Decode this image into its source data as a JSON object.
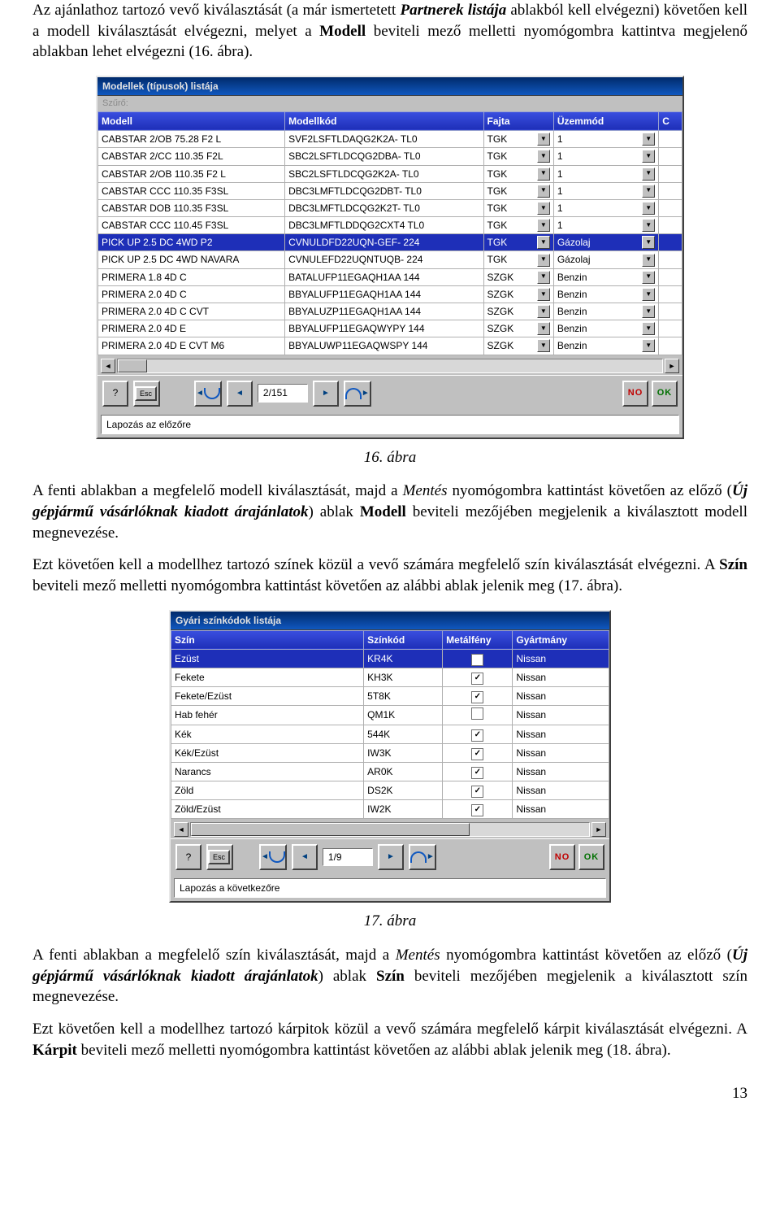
{
  "text": {
    "p1_pre": "Az ajánlathoz tartozó vevő kiválasztását (a már ismertetett ",
    "p1_b1": "Partnerek listája",
    "p1_mid1": " ablakból kell elvégezni) követően kell a modell kiválasztását elvégezni, melyet a ",
    "p1_b2": "Modell",
    "p1_post": " beviteli mező melletti nyomógombra kattintva megjelenő ablakban lehet elvégezni (16. ábra).",
    "cap1": "16. ábra",
    "p2_pre": "A fenti ablakban a megfelelő modell kiválasztását, majd a ",
    "p2_i1": "Mentés",
    "p2_mid1": " nyomógombra kattintást követően az előző (",
    "p2_b1": "Új gépjármű vásárlóknak kiadott árajánlatok",
    "p2_mid2": ") ablak ",
    "p2_b2": "Modell",
    "p2_post": " beviteli mezőjében megjelenik a kiválasztott modell megnevezése.",
    "p3_pre": "Ezt követően kell a modellhez tartozó színek közül a vevő számára megfelelő szín kiválasztását elvégezni. A ",
    "p3_b1": "Szín",
    "p3_post": " beviteli mező melletti nyomógombra kattintást követően az alábbi ablak jelenik meg (17. ábra).",
    "cap2": "17. ábra",
    "p4_pre": "A fenti ablakban a megfelelő szín kiválasztását, majd a ",
    "p4_i1": "Mentés",
    "p4_mid1": " nyomógombra kattintást követően az előző (",
    "p4_b1": "Új gépjármű vásárlóknak kiadott árajánlatok",
    "p4_mid2": ") ablak ",
    "p4_b2": "Szín",
    "p4_post": " beviteli mezőjében megjelenik a kiválasztott szín megnevezése.",
    "p5_pre": "Ezt követően kell a modellhez tartozó kárpitok közül a vevő számára megfelelő kárpit kiválasztását elvégezni. A ",
    "p5_b1": "Kárpit",
    "p5_post": " beviteli mező melletti nyomógombra kattintást követően az alábbi ablak jelenik meg (18. ábra).",
    "pagenum": "13"
  },
  "win1": {
    "title": "Modellek (típusok) listája",
    "hint": "Szűrő:",
    "headers": [
      "Modell",
      "Modellkód",
      "Fajta",
      "Üzemmód",
      "C"
    ],
    "rows": [
      {
        "c": [
          "CABSTAR 2/OB 75.28 F2 L",
          "SVF2LSFTLDAQG2K2A- TL0",
          "TGK",
          "1"
        ]
      },
      {
        "c": [
          "CABSTAR 2/CC 110.35 F2L",
          "SBC2LSFTLDCQG2DBA- TL0",
          "TGK",
          "1"
        ]
      },
      {
        "c": [
          "CABSTAR 2/OB 110.35 F2 L",
          "SBC2LSFTLDCQG2K2A- TL0",
          "TGK",
          "1"
        ]
      },
      {
        "c": [
          "CABSTAR CCC 110.35 F3SL",
          "DBC3LMFTLDCQG2DBT- TL0",
          "TGK",
          "1"
        ]
      },
      {
        "c": [
          "CABSTAR DOB 110.35 F3SL",
          "DBC3LMFTLDCQG2K2T- TL0",
          "TGK",
          "1"
        ]
      },
      {
        "c": [
          "CABSTAR CCC 110.45 F3SL",
          "DBC3LMFTLDDQG2CXT4 TL0",
          "TGK",
          "1"
        ]
      },
      {
        "c": [
          "PICK UP 2.5 DC 4WD P2",
          "CVNULDFD22UQN-GEF- 224",
          "TGK",
          "Gázolaj"
        ],
        "sel": true
      },
      {
        "c": [
          "PICK UP 2.5 DC 4WD NAVARA",
          "CVNULEFD22UQNTUQB- 224",
          "TGK",
          "Gázolaj"
        ]
      },
      {
        "c": [
          "PRIMERA 1.8 4D C",
          "BATALUFP11EGAQH1AA 144",
          "SZGK",
          "Benzin"
        ]
      },
      {
        "c": [
          "PRIMERA 2.0 4D C",
          "BBYALUFP11EGAQH1AA 144",
          "SZGK",
          "Benzin"
        ]
      },
      {
        "c": [
          "PRIMERA 2.0 4D C CVT",
          "BBYALUZP11EGAQH1AA 144",
          "SZGK",
          "Benzin"
        ]
      },
      {
        "c": [
          "PRIMERA 2.0 4D E",
          "BBYALUFP11EGAQWYPY 144",
          "SZGK",
          "Benzin"
        ]
      },
      {
        "c": [
          "PRIMERA 2.0 4D E CVT M6",
          "BBYALUWP11EGAQWSPY 144",
          "SZGK",
          "Benzin"
        ]
      }
    ],
    "page": "2/151",
    "status": "Lapozás az előzőre",
    "no": "NO",
    "ok": "OK"
  },
  "win2": {
    "title": "Gyári színkódok listája",
    "headers": [
      "Szín",
      "Színkód",
      "Metálfény",
      "Gyártmány"
    ],
    "rows": [
      {
        "c": [
          "Ezüst",
          "KR4K",
          true,
          "Nissan"
        ],
        "sel": true
      },
      {
        "c": [
          "Fekete",
          "KH3K",
          true,
          "Nissan"
        ]
      },
      {
        "c": [
          "Fekete/Ezüst",
          "5T8K",
          true,
          "Nissan"
        ]
      },
      {
        "c": [
          "Hab fehér",
          "QM1K",
          false,
          "Nissan"
        ]
      },
      {
        "c": [
          "Kék",
          "544K",
          true,
          "Nissan"
        ]
      },
      {
        "c": [
          "Kék/Ezüst",
          "IW3K",
          true,
          "Nissan"
        ]
      },
      {
        "c": [
          "Narancs",
          "AR0K",
          true,
          "Nissan"
        ]
      },
      {
        "c": [
          "Zöld",
          "DS2K",
          true,
          "Nissan"
        ]
      },
      {
        "c": [
          "Zöld/Ezüst",
          "IW2K",
          true,
          "Nissan"
        ]
      }
    ],
    "page": "1/9",
    "status": "Lapozás a következőre",
    "no": "NO",
    "ok": "OK"
  }
}
